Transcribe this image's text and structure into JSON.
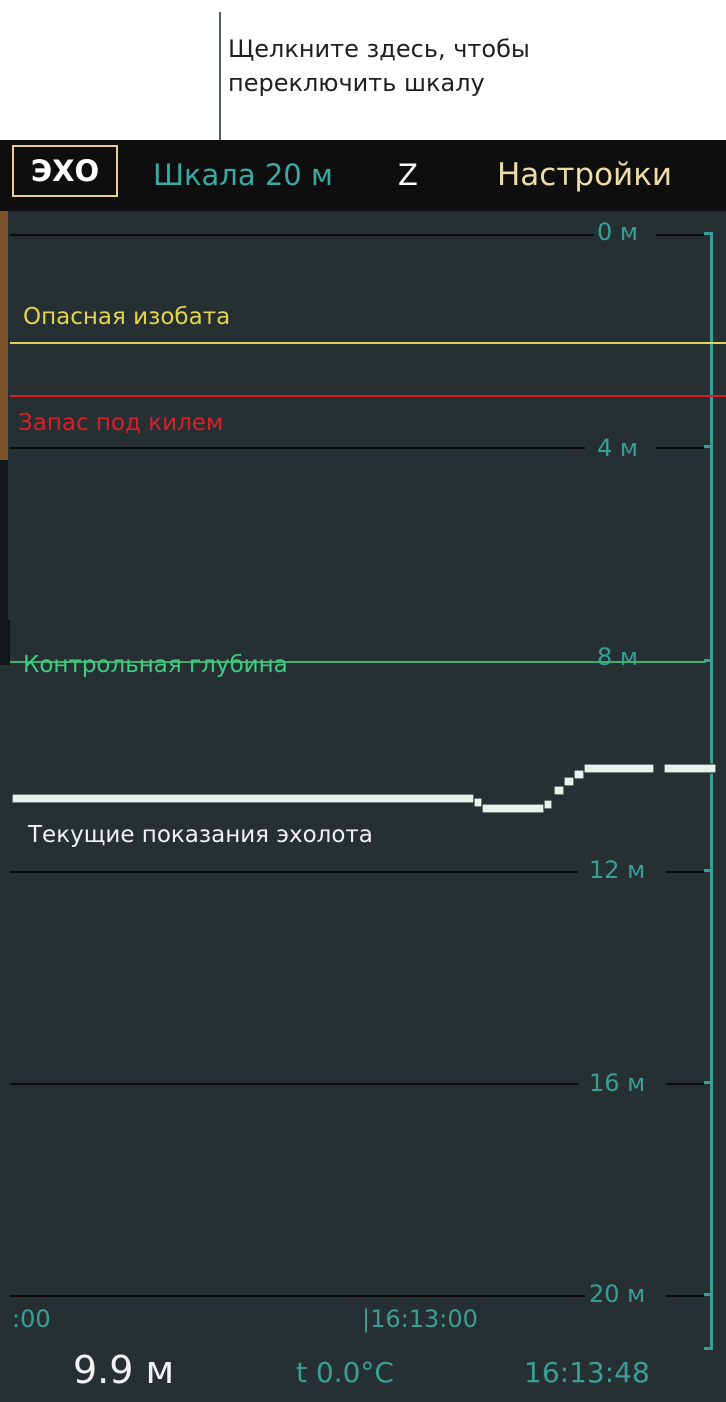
{
  "callout": {
    "line1": "Щелкните здесь, чтобы",
    "line2": "переключить шкалу"
  },
  "topbar": {
    "echo_label": "ЭХО",
    "scale_label": "Шкала 20 м",
    "z_label": "Z",
    "settings_label": "Настройки"
  },
  "depth_scale": {
    "labels": [
      "0 м",
      "4 м",
      "8 м",
      "12 м",
      "16 м",
      "20 м"
    ]
  },
  "markers": {
    "danger_contour": "Опасная изобата",
    "keel_clearance": "Запас под килем",
    "control_depth": "Контрольная глубина",
    "current_reading": "Текущие показания эхолота"
  },
  "bottom": {
    "time_left": ":00",
    "time_mid": "|16:13:00",
    "depth_value": "9.9 м",
    "temperature": "t 0.0°C",
    "clock": "16:13:48"
  },
  "colors": {
    "background": "#263033",
    "accent_teal": "#3a9e97",
    "danger_yellow": "#dcd35f",
    "keel_red": "#d91f26",
    "control_green": "#3fae6e",
    "echo_trace": "#e6f2ea"
  }
}
